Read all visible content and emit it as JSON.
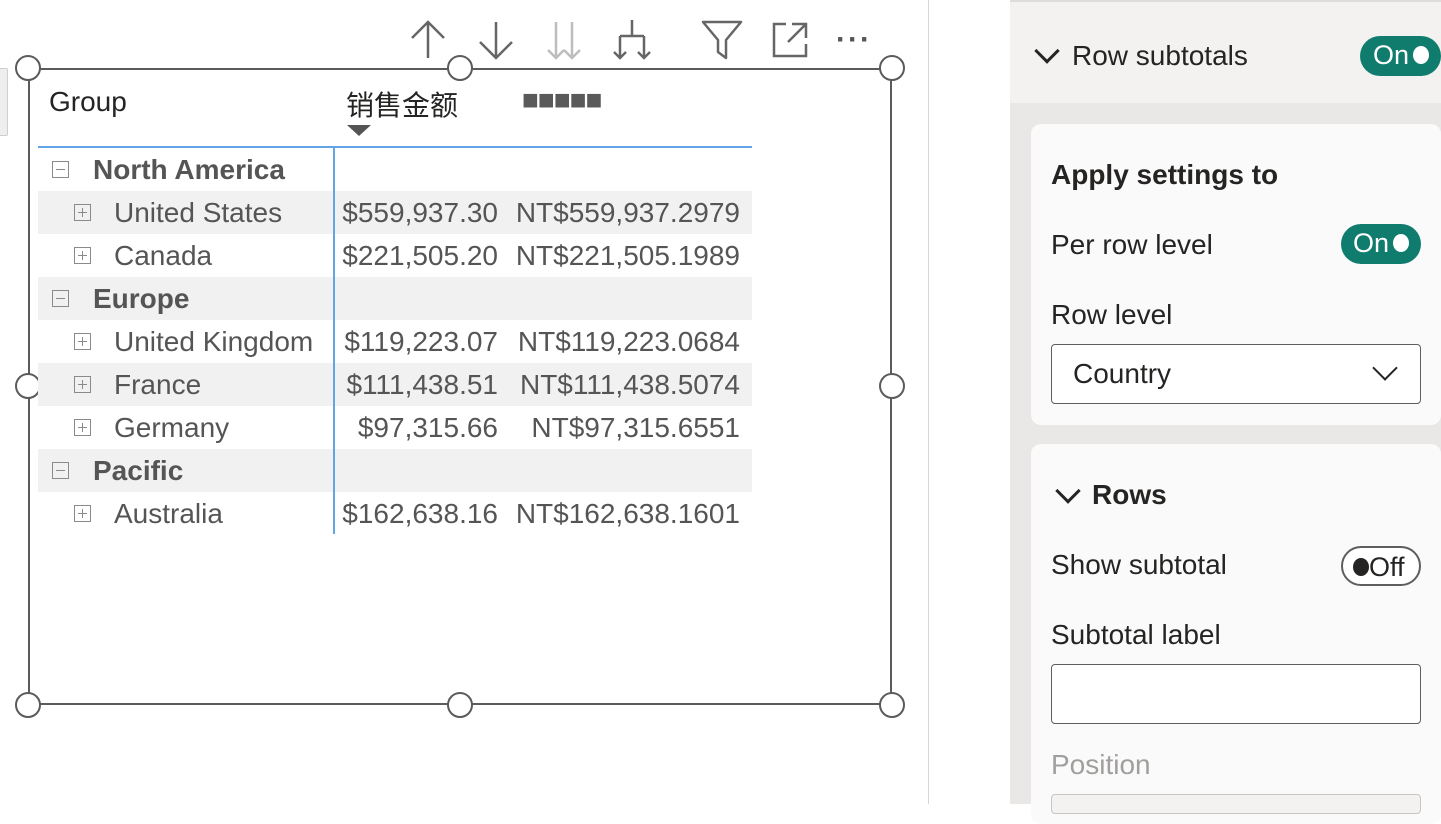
{
  "toolbar": {
    "buttons": [
      {
        "name": "sort-ascending-icon"
      },
      {
        "name": "sort-descending-icon"
      },
      {
        "name": "expand-all-icon"
      },
      {
        "name": "drill-down-icon"
      },
      {
        "name": "filter-icon"
      },
      {
        "name": "focus-mode-icon"
      }
    ],
    "more_label": "···"
  },
  "matrix": {
    "headers": {
      "group": "Group",
      "col1": "销售金额",
      "col2": "■■■■■"
    },
    "rows": [
      {
        "type": "group",
        "label": "North America",
        "shaded": false
      },
      {
        "type": "country",
        "label": "United States",
        "v1": "$559,937.30",
        "v2": "NT$559,937.2979",
        "shaded": true
      },
      {
        "type": "country",
        "label": "Canada",
        "v1": "$221,505.20",
        "v2": "NT$221,505.1989",
        "shaded": false
      },
      {
        "type": "group",
        "label": "Europe",
        "shaded": true
      },
      {
        "type": "country",
        "label": "United Kingdom",
        "v1": "$119,223.07",
        "v2": "NT$119,223.0684",
        "shaded": false
      },
      {
        "type": "country",
        "label": "France",
        "v1": "$111,438.51",
        "v2": "NT$111,438.5074",
        "shaded": true
      },
      {
        "type": "country",
        "label": "Germany",
        "v1": "$97,315.66",
        "v2": "NT$97,315.6551",
        "shaded": false
      },
      {
        "type": "group",
        "label": "Pacific",
        "shaded": true
      },
      {
        "type": "country",
        "label": "Australia",
        "v1": "$162,638.16",
        "v2": "NT$162,638.1601",
        "shaded": false
      }
    ]
  },
  "pane": {
    "row_subtotals": {
      "title": "Row subtotals",
      "toggle": "On"
    },
    "apply_settings": {
      "title": "Apply settings to",
      "per_row_level_label": "Per row level",
      "per_row_level_toggle": "On",
      "row_level_label": "Row level",
      "row_level_value": "Country"
    },
    "rows_section": {
      "title": "Rows",
      "show_subtotal_label": "Show subtotal",
      "show_subtotal_toggle": "Off",
      "subtotal_label_label": "Subtotal label",
      "subtotal_label_value": "",
      "position_label": "Position"
    }
  },
  "colors": {
    "accent_toggle": "#107c6e",
    "matrix_separator": "#61a5e6",
    "row_shade": "#f1f1f1",
    "pane_background": "#e9e8e7"
  }
}
